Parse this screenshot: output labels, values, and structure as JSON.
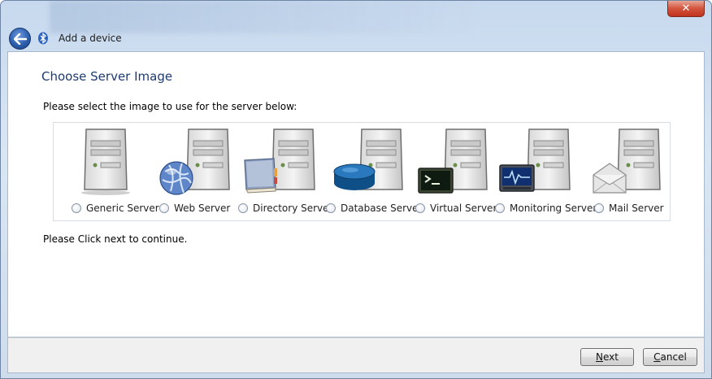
{
  "window": {
    "title": "Add a device",
    "close_glyph": "✕"
  },
  "page": {
    "heading": "Choose Server Image",
    "instruction": "Please select the image to use for the server below:",
    "continue_text": "Please Click next to continue."
  },
  "server_images": [
    {
      "label": "Generic Server",
      "icon": "generic-server-icon",
      "selected": false
    },
    {
      "label": "Web Server",
      "icon": "web-server-icon",
      "selected": false
    },
    {
      "label": "Directory Server",
      "icon": "directory-server-icon",
      "selected": false
    },
    {
      "label": "Database Server",
      "icon": "database-server-icon",
      "selected": false
    },
    {
      "label": "Virtual Server",
      "icon": "virtual-server-icon",
      "selected": false
    },
    {
      "label": "Monitoring Server",
      "icon": "monitoring-server-icon",
      "selected": false
    },
    {
      "label": "Mail Server",
      "icon": "mail-server-icon",
      "selected": false
    }
  ],
  "buttons": {
    "next_accel": "N",
    "next_rest": "ext",
    "cancel_accel": "C",
    "cancel_rest": "ancel"
  },
  "colors": {
    "heading": "#1f3b6e",
    "frame": "#c7d9ee",
    "close": "#c0321e"
  }
}
